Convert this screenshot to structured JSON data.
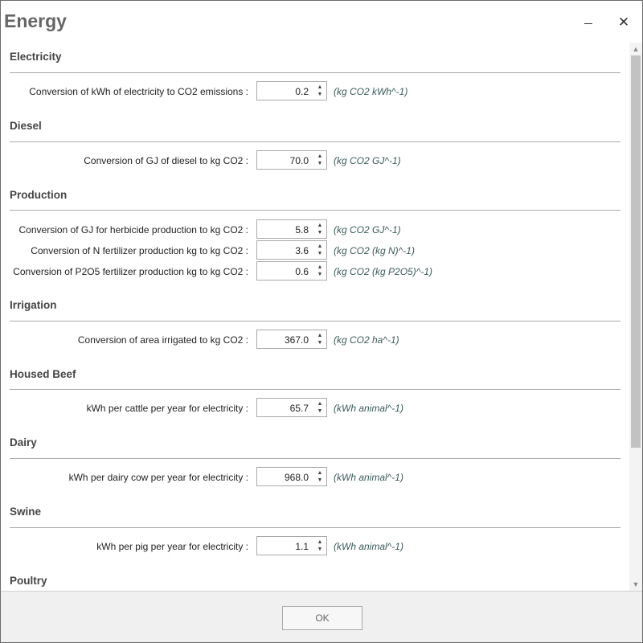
{
  "window": {
    "title": "Energy",
    "minimize_icon": "minimize-icon",
    "close_icon": "close-icon"
  },
  "sections": [
    {
      "title": "Electricity",
      "rows": [
        {
          "label": "Conversion of kWh of electricity to CO2 emissions :",
          "value": "0.2",
          "unit": "(kg CO2 kWh^-1)"
        }
      ]
    },
    {
      "title": "Diesel",
      "rows": [
        {
          "label": "Conversion of GJ of diesel to kg CO2 :",
          "value": "70.0",
          "unit": "(kg CO2 GJ^-1)"
        }
      ]
    },
    {
      "title": "Production",
      "rows": [
        {
          "label": "Conversion of GJ for herbicide production to kg CO2 :",
          "value": "5.8",
          "unit": "(kg CO2 GJ^-1)"
        },
        {
          "label": "Conversion of N fertilizer production kg to kg CO2 :",
          "value": "3.6",
          "unit": "(kg CO2 (kg N)^-1)"
        },
        {
          "label": "Conversion of P2O5 fertilizer production kg to kg CO2 :",
          "value": "0.6",
          "unit": "(kg CO2 (kg P2O5)^-1)"
        }
      ]
    },
    {
      "title": "Irrigation",
      "rows": [
        {
          "label": "Conversion of area irrigated to kg CO2 :",
          "value": "367.0",
          "unit": "(kg CO2 ha^-1)"
        }
      ]
    },
    {
      "title": "Housed Beef",
      "rows": [
        {
          "label": "kWh per cattle per year for electricity :",
          "value": "65.7",
          "unit": "(kWh animal^-1)"
        }
      ]
    },
    {
      "title": "Dairy",
      "rows": [
        {
          "label": "kWh per dairy cow per year for electricity :",
          "value": "968.0",
          "unit": "(kWh animal^-1)"
        }
      ]
    },
    {
      "title": "Swine",
      "rows": [
        {
          "label": "kWh per pig per year for electricity :",
          "value": "1.1",
          "unit": "(kWh animal^-1)"
        }
      ]
    },
    {
      "title": "Poultry",
      "rows": []
    }
  ],
  "footer": {
    "ok_label": "OK"
  }
}
